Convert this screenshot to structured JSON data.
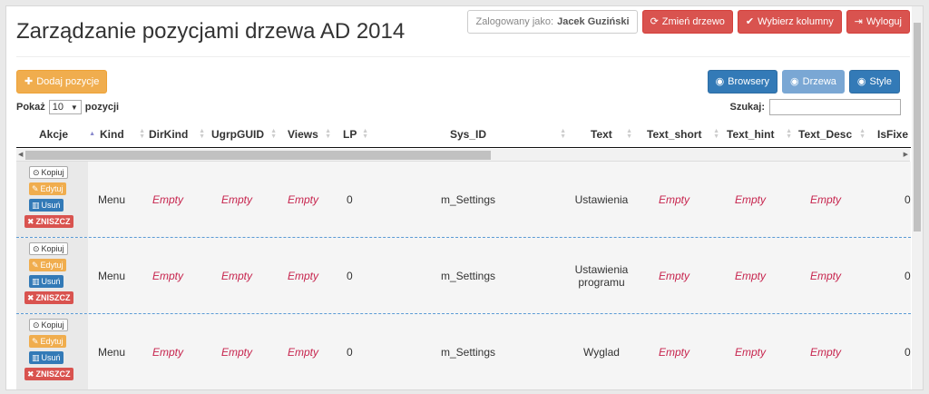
{
  "header": {
    "title": "Zarządzanie pozycjami drzewa AD 2014",
    "logged_label": "Zalogowany jako:",
    "user": "Jacek Guziński",
    "buttons": {
      "change_tree": "Zmień drzewo",
      "choose_columns": "Wybierz kolumny",
      "logout": "Wyloguj"
    }
  },
  "toolbar": {
    "add_label": "Dodaj pozycje",
    "views": [
      "Browsery",
      "Drzewa",
      "Style"
    ]
  },
  "table_controls": {
    "show_label": "Pokaż",
    "page_size": "10",
    "entries_label": "pozycji",
    "search_label": "Szukaj:"
  },
  "columns": [
    "Akcje",
    "Kind",
    "DirKind",
    "UgrpGUID",
    "Views",
    "LP",
    "Sys_ID",
    "Text",
    "Text_short",
    "Text_hint",
    "Text_Desc",
    "IsFixe"
  ],
  "action_labels": {
    "copy": "Kopiuj",
    "edit": "Edytuj",
    "delete": "Usuń",
    "destroy": "ZNISZCZ"
  },
  "empty_text": "Empty",
  "rows": [
    {
      "kind": "Menu",
      "lp": "0",
      "sys_id": "m_Settings",
      "text": "Ustawienia",
      "is_fixed": "0"
    },
    {
      "kind": "Menu",
      "lp": "0",
      "sys_id": "m_Settings",
      "text": "Ustawienia programu",
      "is_fixed": "0"
    },
    {
      "kind": "Menu",
      "lp": "0",
      "sys_id": "m_Settings",
      "text": "Wyglad",
      "is_fixed": "0"
    }
  ]
}
